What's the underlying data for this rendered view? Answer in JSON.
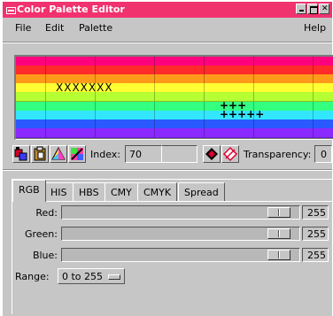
{
  "window": {
    "title": "Color Palette Editor"
  },
  "menubar": {
    "items": [
      "File",
      "Edit",
      "Palette"
    ],
    "help": "Help"
  },
  "palette": {
    "rows": [
      "#ff007f",
      "#ff2a2a",
      "#ff9a1a",
      "#ffff33",
      "#b5ff33",
      "#33ff80",
      "#33e6ff",
      "#2a5aff",
      "#8a2aff"
    ],
    "selected_label": "XXXXXXX",
    "plus_row_1": "+++",
    "plus_row_2": "+++++"
  },
  "toolbar": {
    "index_label": "Index:",
    "index_value": "70",
    "transparency_label": "Transparency:",
    "transparency_value": "0"
  },
  "tabs": [
    "RGB",
    "HIS",
    "HBS",
    "CMY",
    "CMYK",
    "Spread"
  ],
  "active_tab": "RGB",
  "sliders": [
    {
      "label": "Red:",
      "value": "255",
      "fraction": 1.0
    },
    {
      "label": "Green:",
      "value": "255",
      "fraction": 1.0
    },
    {
      "label": "Blue:",
      "value": "255",
      "fraction": 1.0
    }
  ],
  "range": {
    "label": "Range:",
    "value": "0 to 255"
  },
  "colors": {
    "titlebar": "#f0326e",
    "window_bg": "#c6c6c6"
  }
}
